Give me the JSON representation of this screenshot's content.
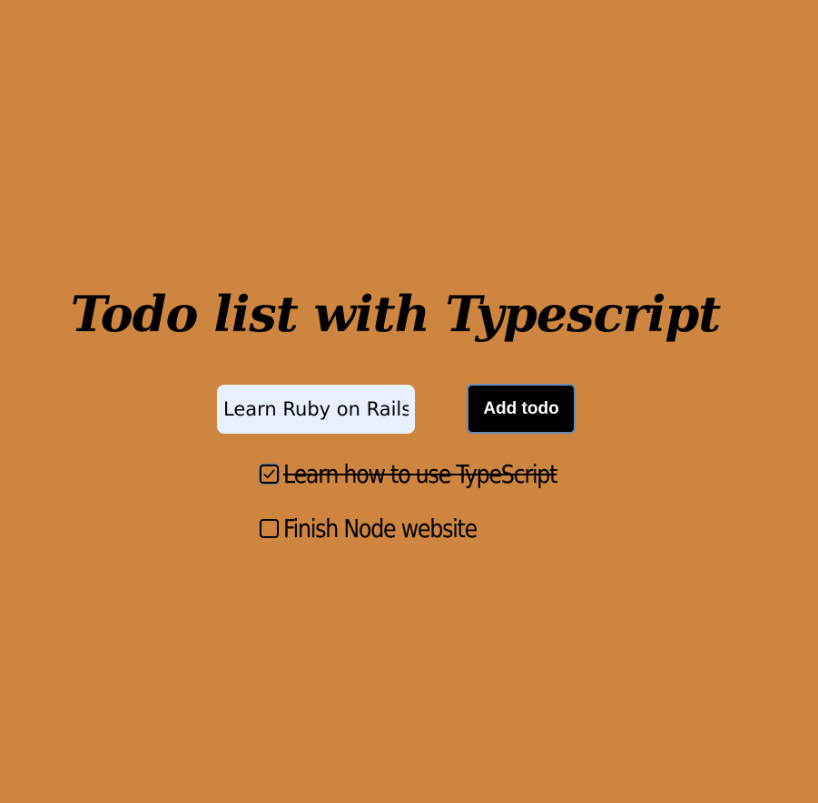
{
  "page": {
    "background_color": "#cd853f",
    "title": "Todo list with Typescript"
  },
  "form": {
    "input_value": "Learn Ruby on Rails",
    "input_background": "#e8f0fe",
    "add_button_label": "Add todo"
  },
  "todos": [
    {
      "text": "Learn how to use TypeScript",
      "completed": true
    },
    {
      "text": "Finish Node website",
      "completed": false
    }
  ]
}
